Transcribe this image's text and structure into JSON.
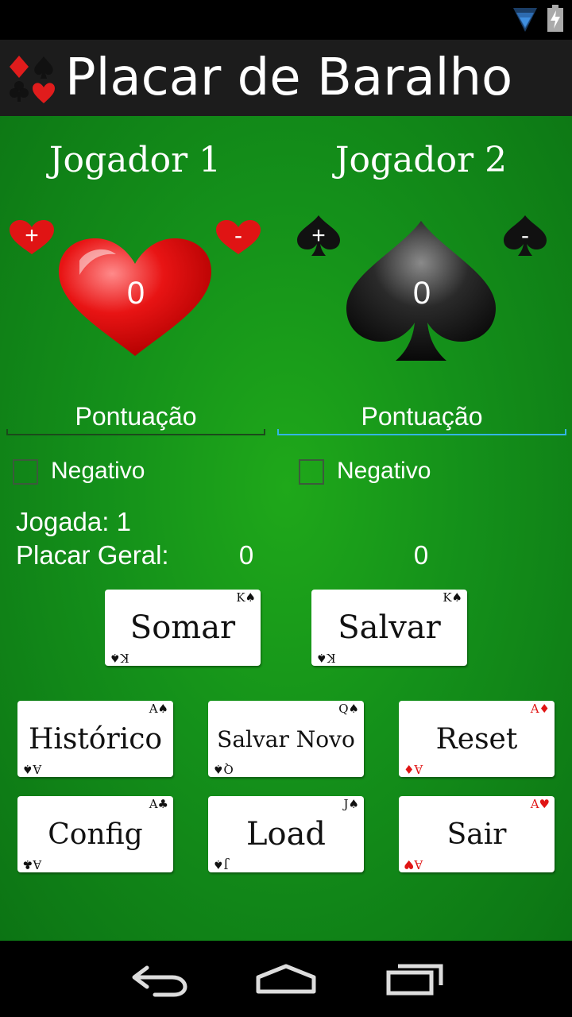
{
  "app": {
    "title": "Placar de Baralho"
  },
  "players": [
    {
      "name": "Jogador 1",
      "score": "0",
      "plus": "+",
      "minus": "-",
      "field_placeholder": "Pontuação",
      "negative_label": "Negativo",
      "total": "0",
      "suit_icon": "heart-icon"
    },
    {
      "name": "Jogador 2",
      "score": "0",
      "plus": "+",
      "minus": "-",
      "field_placeholder": "Pontuação",
      "negative_label": "Negativo",
      "total": "0",
      "suit_icon": "spade-icon"
    }
  ],
  "round": {
    "label": "Jogada: 1"
  },
  "overall": {
    "label": "Placar Geral:"
  },
  "buttons": {
    "somar": {
      "label": "Somar",
      "corner": "K♠"
    },
    "salvar": {
      "label": "Salvar",
      "corner": "K♠"
    },
    "historico": {
      "label": "Histórico",
      "corner": "A♠"
    },
    "salvar_novo": {
      "label": "Salvar Novo",
      "corner": "Q♠"
    },
    "reset": {
      "label": "Reset",
      "corner": "A♦"
    },
    "config": {
      "label": "Config",
      "corner": "A♣"
    },
    "load": {
      "label": "Load",
      "corner": "J♠"
    },
    "sair": {
      "label": "Sair",
      "corner": "A♥"
    }
  },
  "colors": {
    "felt": "#14901a",
    "heart": "#e01010",
    "spade": "#111111",
    "accent": "#33b5e5"
  }
}
